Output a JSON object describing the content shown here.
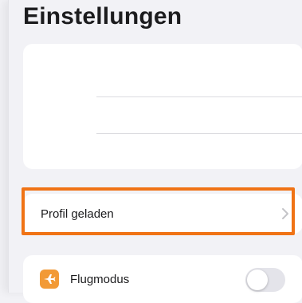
{
  "header": {
    "title": "Einstellungen"
  },
  "profile": {
    "label": "Profil geladen"
  },
  "flight_mode": {
    "label": "Flugmodus",
    "enabled": false,
    "icon": "airplane-icon"
  },
  "colors": {
    "accent_orange": "#f07315",
    "flight_icon_bg": "#f29a36"
  }
}
